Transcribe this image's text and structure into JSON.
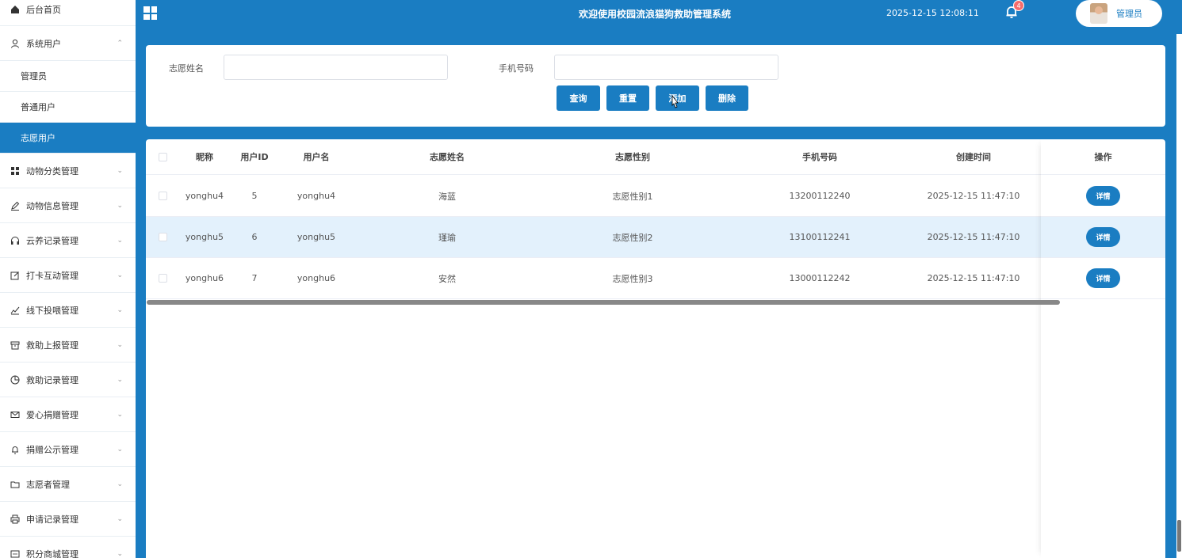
{
  "sidebar": {
    "home": "后台首页",
    "system_user": "系统用户",
    "sub_items": [
      "管理员",
      "普通用户",
      "志愿用户"
    ],
    "menus": [
      {
        "label": "动物分类管理",
        "icon": "grid-icon"
      },
      {
        "label": "动物信息管理",
        "icon": "edit-icon"
      },
      {
        "label": "云养记录管理",
        "icon": "headset-icon"
      },
      {
        "label": "打卡互动管理",
        "icon": "edit-box-icon"
      },
      {
        "label": "线下投喂管理",
        "icon": "chart-icon"
      },
      {
        "label": "救助上报管理",
        "icon": "archive-icon"
      },
      {
        "label": "救助记录管理",
        "icon": "pie-icon"
      },
      {
        "label": "爱心捐赠管理",
        "icon": "mail-icon"
      },
      {
        "label": "捐赠公示管理",
        "icon": "bell-icon"
      },
      {
        "label": "志愿者管理",
        "icon": "folder-icon"
      },
      {
        "label": "申请记录管理",
        "icon": "printer-icon"
      },
      {
        "label": "积分商城管理",
        "icon": "message-icon"
      }
    ]
  },
  "header": {
    "title": "欢迎使用校园流浪猫狗救助管理系统",
    "datetime": "2025-12-15 12:08:11",
    "notification_count": "4",
    "user_label": "管理员"
  },
  "search": {
    "volunteer_name_label": "志愿姓名",
    "volunteer_name_value": "",
    "phone_label": "手机号码",
    "phone_value": "",
    "query_button": "查询",
    "reset_button": "重置",
    "add_button": "添加",
    "delete_button": "删除"
  },
  "table": {
    "columns": [
      "昵称",
      "用户ID",
      "用户名",
      "志愿姓名",
      "志愿性别",
      "手机号码",
      "创建时间",
      "操作"
    ],
    "rows": [
      {
        "nickname": "yonghu4",
        "user_id": "5",
        "username": "yonghu4",
        "volunteer_name": "海蓝",
        "gender": "志愿性别1",
        "phone": "13200112240",
        "created": "2025-12-15 11:47:10",
        "action": "详情"
      },
      {
        "nickname": "yonghu5",
        "user_id": "6",
        "username": "yonghu5",
        "volunteer_name": "瑾瑜",
        "gender": "志愿性别2",
        "phone": "13100112241",
        "created": "2025-12-15 11:47:10",
        "action": "详情"
      },
      {
        "nickname": "yonghu6",
        "user_id": "7",
        "username": "yonghu6",
        "volunteer_name": "安然",
        "gender": "志愿性别3",
        "phone": "13000112242",
        "created": "2025-12-15 11:47:10",
        "action": "详情"
      }
    ]
  },
  "colors": {
    "primary": "#1a7dc2",
    "row_highlight": "#e3f1fc",
    "badge": "#f56c6c"
  }
}
